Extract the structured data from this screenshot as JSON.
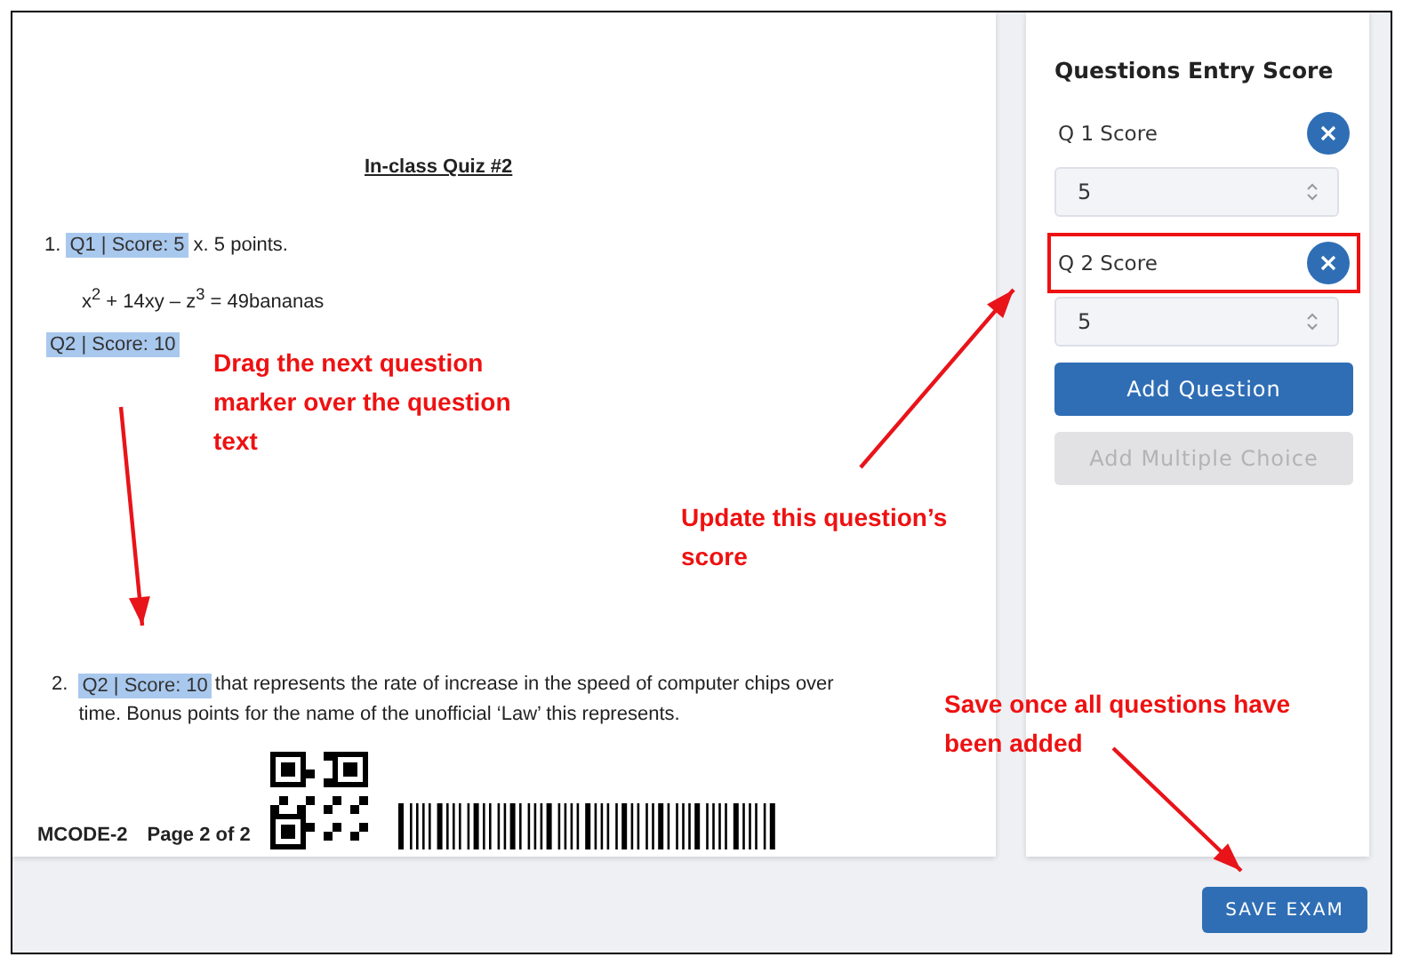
{
  "document": {
    "title": "In-class Quiz #2",
    "blocks": [
      {
        "kind": "question",
        "number": "1.",
        "marker": "Q1 | Score: 5",
        "text": "x. 5 points."
      },
      {
        "kind": "equation",
        "text": "x$^{2}$ + 14xy – z$^{3}$ = 49bananas"
      },
      {
        "kind": "marker",
        "marker": "Q2 | Score: 10"
      }
    ],
    "question_2": {
      "number": "2.",
      "marker": "Q2 | Score: 10",
      "lines": [
        "that represents the rate of increase in the speed of computer chips over",
        "time. Bonus points for the name of the unofficial ‘Law’ this represents."
      ]
    },
    "footer": {
      "code": "MCODE-2",
      "page": "Page 2 of 2"
    }
  },
  "sidebar": {
    "title": "Questions Entry Score",
    "entries": [
      {
        "label": "Q 1 Score",
        "value": "5",
        "highlighted": false
      },
      {
        "label": "Q 2 Score",
        "value": "5",
        "highlighted": true
      }
    ],
    "buttons": [
      {
        "label": "Add Question",
        "disabled": false
      },
      {
        "label": "Add Multiple Choice",
        "disabled": true
      }
    ]
  },
  "save_button": "SAVE EXAM",
  "annotations": [
    "Drag the next question marker over the question text",
    "Update this question’s score",
    "Save once all questions have been added"
  ]
}
